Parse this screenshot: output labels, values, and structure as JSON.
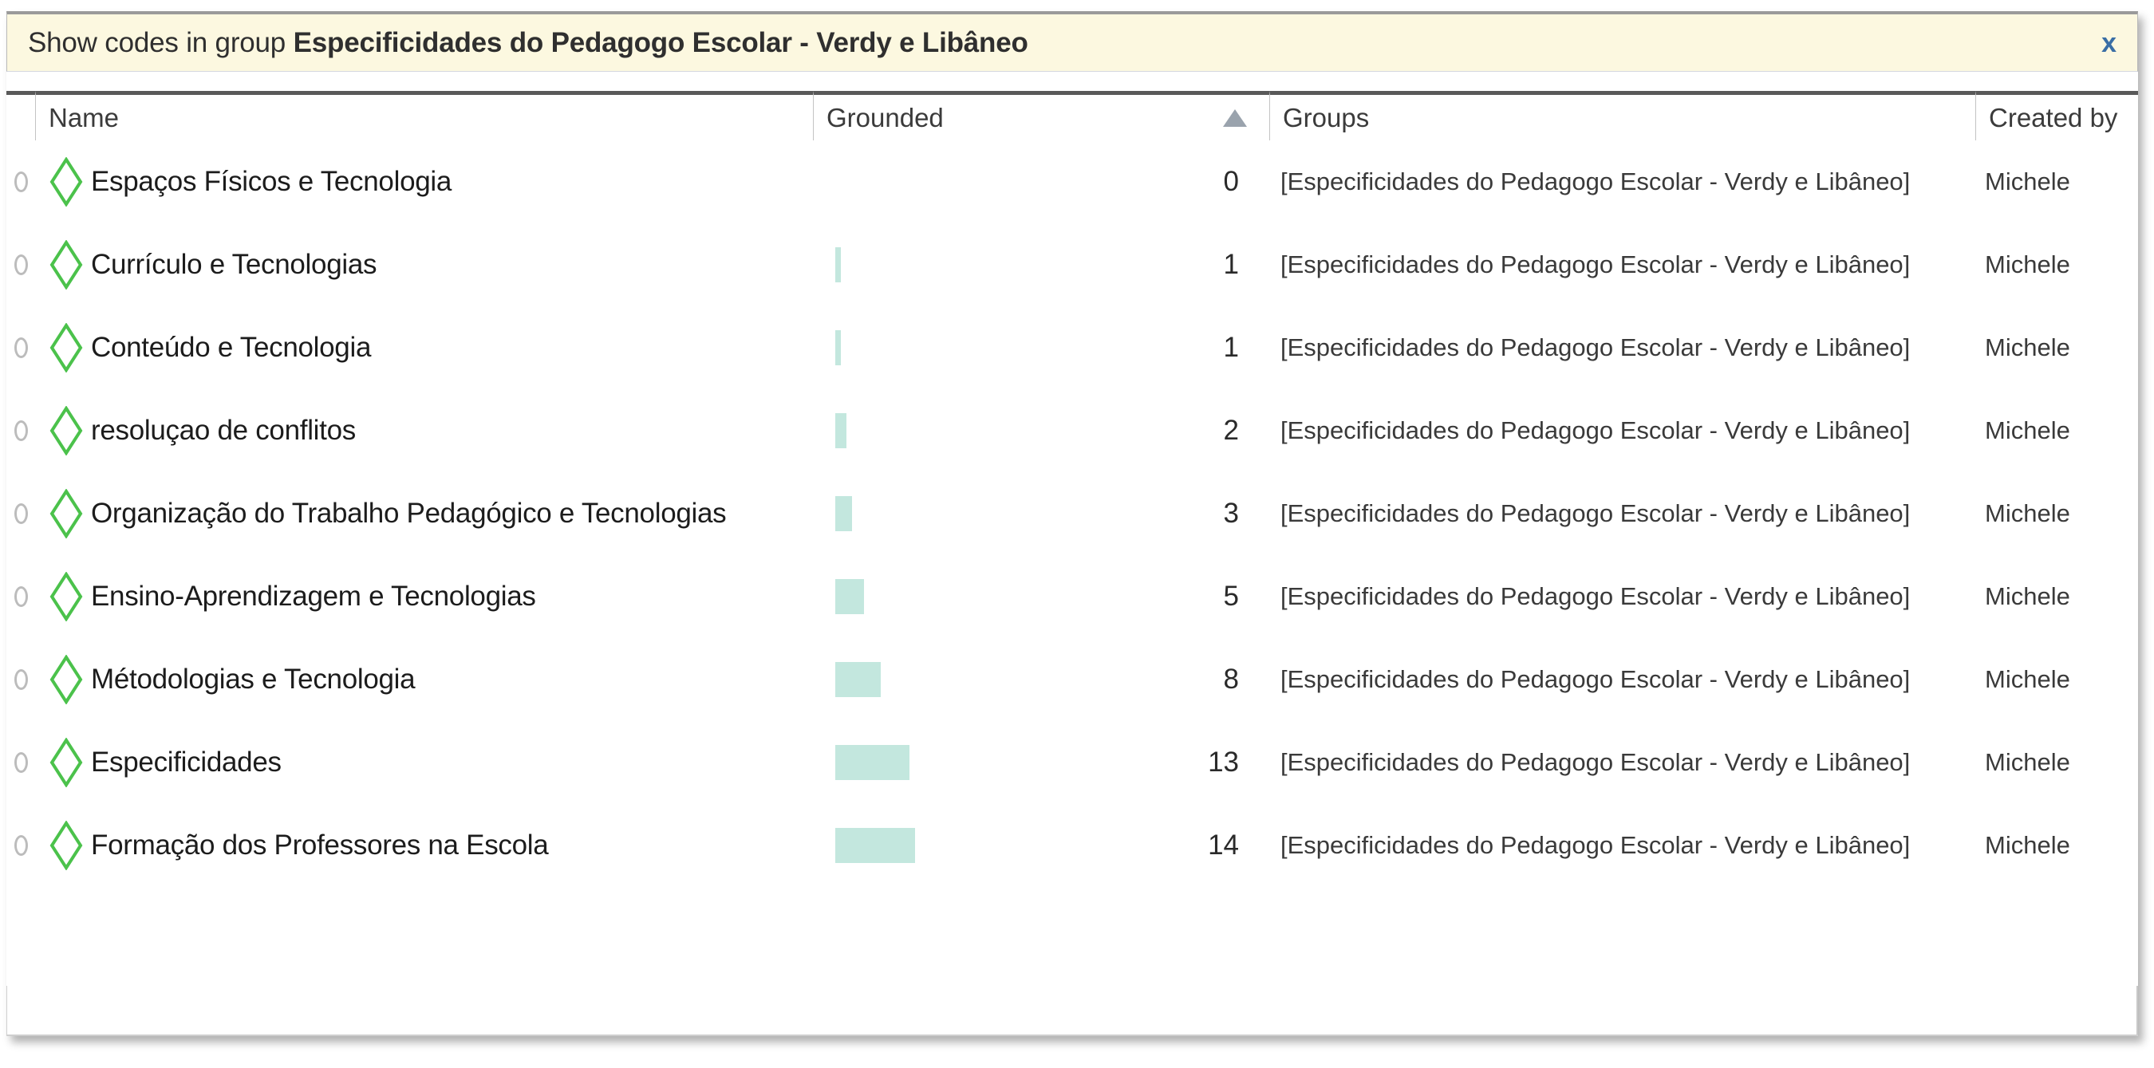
{
  "filter_banner": {
    "prefix": "Show codes in group",
    "group_name": "Especificidades do Pedagogo Escolar - Verdy e Libâneo",
    "close_label": "x",
    "background_color": "#fcf8e0",
    "close_color": "#3a6ea5"
  },
  "table": {
    "columns": [
      {
        "key": "marker",
        "label": ""
      },
      {
        "key": "name",
        "label": "Name"
      },
      {
        "key": "grounded",
        "label": "Grounded",
        "sorted": "ascending",
        "sort_indicator": "▲"
      },
      {
        "key": "groups",
        "label": "Groups"
      },
      {
        "key": "created_by",
        "label": "Created by"
      }
    ],
    "sort": {
      "column": "Grounded",
      "direction": "ascending"
    },
    "max_grounded": 14,
    "bar_color": "#c3e7de",
    "code_icon_color": "#4bc24b",
    "rows": [
      {
        "name": "Espaços Físicos e Tecnologia",
        "grounded": 0,
        "groups": "[Especificidades do Pedagogo Escolar - Verdy e Libâneo]",
        "created_by": "Michele"
      },
      {
        "name": "Currículo e Tecnologias",
        "grounded": 1,
        "groups": "[Especificidades do Pedagogo Escolar - Verdy e Libâneo]",
        "created_by": "Michele"
      },
      {
        "name": "Conteúdo e Tecnologia",
        "grounded": 1,
        "groups": "[Especificidades do Pedagogo Escolar - Verdy e Libâneo]",
        "created_by": "Michele"
      },
      {
        "name": "resoluçao de conflitos",
        "grounded": 2,
        "groups": "[Especificidades do Pedagogo Escolar - Verdy e Libâneo]",
        "created_by": "Michele"
      },
      {
        "name": "Organização do Trabalho Pedagógico e Tecnologias",
        "grounded": 3,
        "groups": "[Especificidades do Pedagogo Escolar - Verdy e Libâneo]",
        "created_by": "Michele"
      },
      {
        "name": "Ensino-Aprendizagem e Tecnologias",
        "grounded": 5,
        "groups": "[Especificidades do Pedagogo Escolar - Verdy e Libâneo]",
        "created_by": "Michele"
      },
      {
        "name": "Métodologias e Tecnologia",
        "grounded": 8,
        "groups": "[Especificidades do Pedagogo Escolar - Verdy e Libâneo]",
        "created_by": "Michele"
      },
      {
        "name": "Especificidades",
        "grounded": 13,
        "groups": "[Especificidades do Pedagogo Escolar - Verdy e Libâneo]",
        "created_by": "Michele"
      },
      {
        "name": "Formação dos Professores na Escola",
        "grounded": 14,
        "groups": "[Especificidades do Pedagogo Escolar - Verdy e Libâneo]",
        "created_by": "Michele"
      }
    ]
  }
}
